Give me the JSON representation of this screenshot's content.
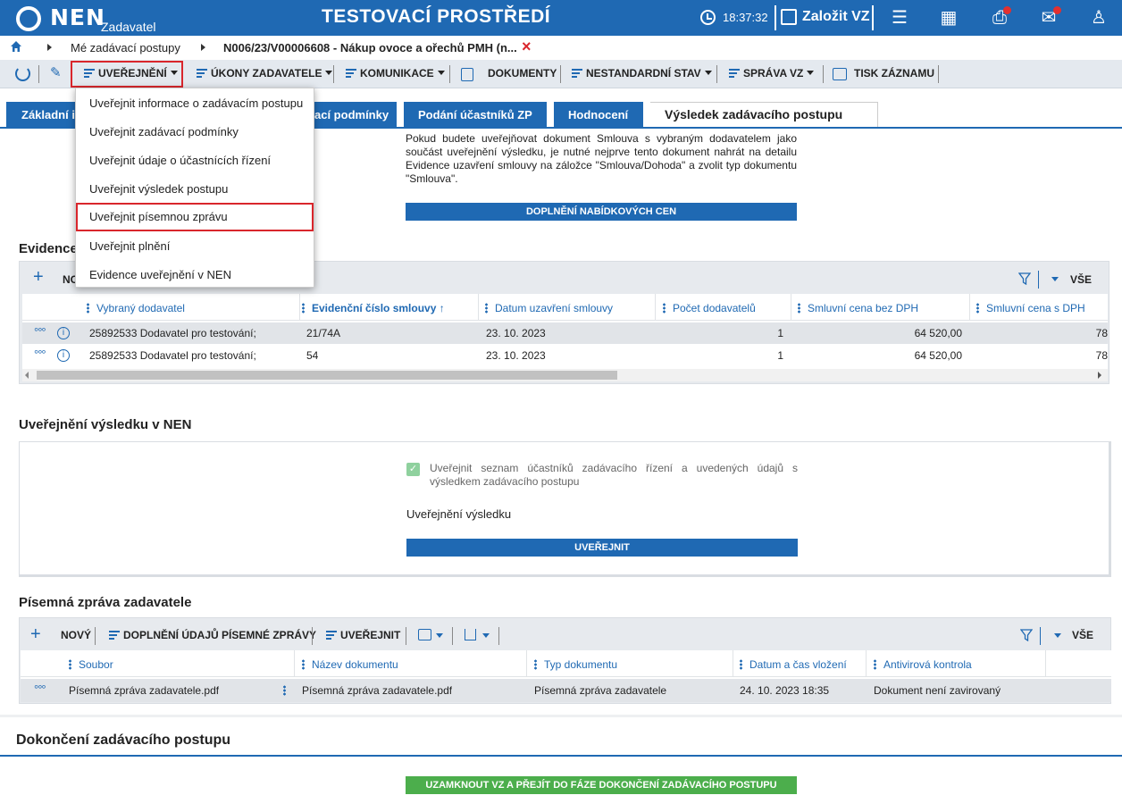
{
  "header": {
    "logo": "NEN",
    "logo_sub": "Zadavatel",
    "env_title": "TESTOVACÍ PROSTŘEDÍ",
    "clock": "18:37:32",
    "create_label": "Založit VZ"
  },
  "breadcrumb": {
    "item1": "Mé zadávací postupy",
    "item2": "N006/23/V00006608 - Nákup ovoce a ořechů PMH (n...",
    "close": "×"
  },
  "toolbar": {
    "uverejneni": "UVEŘEJNĚNÍ",
    "ukony": "ÚKONY ZADAVATELE",
    "komunikace": "KOMUNIKACE",
    "dokumenty": "DOKUMENTY",
    "nestandardni": "NESTANDARDNÍ STAV",
    "sprava": "SPRÁVA VZ",
    "tisk": "TISK ZÁZNAMU"
  },
  "dropdown": {
    "items": [
      "Uveřejnit informace o zadávacím postupu",
      "Uveřejnit zadávací podmínky",
      "Uveřejnit údaje o účastnících řízení",
      "Uveřejnit výsledek postupu",
      "Uveřejnit písemnou zprávu",
      "Uveřejnit plnění",
      "Evidence uveřejnění v NEN"
    ]
  },
  "tabs": {
    "t1": "Základní i",
    "t2": "ací podmínky",
    "t3": "Podání účastníků ZP",
    "t4": "Hodnocení",
    "active": "Výsledek zadávacího postupu"
  },
  "info": {
    "text": "Pokud budete uveřejňovat dokument Smlouva s vybraným dodavatelem jako součást uveřejnění výsledku, je nutné nejprve tento dokument nahrát na detailu Evidence uzavření smlouvy na záložce \"Smlouva/Dohoda\" a zvolit typ dokumentu \"Smlouva\".",
    "button": "DOPLNĚNÍ NABÍDKOVÝCH CEN"
  },
  "evidence": {
    "title": "Evidence",
    "new_label": "NO",
    "all_label": "VŠE",
    "columns": [
      "Vybraný dodavatel",
      "Evidenční číslo smlouvy",
      "Datum uzavření smlouvy",
      "Počet dodavatelů",
      "Smluvní cena bez DPH",
      "Smluvní cena s DPH"
    ],
    "sort_arrow": "↑",
    "rows": [
      {
        "dodavatel": "25892533 Dodavatel pro testování;",
        "cislo": "21/74A",
        "datum": "23. 10. 2023",
        "pocet": "1",
        "bez_dph": "64 520,00",
        "s_dph": "78"
      },
      {
        "dodavatel": "25892533 Dodavatel pro testování;",
        "cislo": "54",
        "datum": "23. 10. 2023",
        "pocet": "1",
        "bez_dph": "64 520,00",
        "s_dph": "78"
      }
    ]
  },
  "publication": {
    "title": "Uveřejnění výsledku v NEN",
    "checkbox_label": "Uveřejnit seznam účastníků zadávacího řízení a uvedených údajů s výsledkem zadávacího postupu",
    "checked": true,
    "subtitle": "Uveřejnění výsledku",
    "button": "UVEŘEJNIT"
  },
  "report": {
    "title": "Písemná zpráva zadavatele",
    "new": "NOVÝ",
    "doplneni": "DOPLNĚNÍ ÚDAJŮ PÍSEMNÉ ZPRÁVY",
    "uverejnit": "UVEŘEJNIT",
    "all_label": "VŠE",
    "columns": [
      "Soubor",
      "Název dokumentu",
      "Typ dokumentu",
      "Datum a čas vložení",
      "Antivirová kontrola"
    ],
    "row": {
      "soubor": "Písemná zpráva zadavatele.pdf",
      "nazev": "Písemná zpráva zadavatele.pdf",
      "typ": "Písemná zpráva zadavatele",
      "datum": "24. 10. 2023 18:35",
      "antivir": "Dokument není zavirovaný"
    }
  },
  "completion": {
    "title": "Dokončení zadávacího postupu",
    "button": "UZAMKNOUT VZ A PŘEJÍT DO FÁZE DOKONČENÍ ZADÁVACÍHO POSTUPU"
  },
  "colors": {
    "primary": "#1f69b3",
    "highlight": "#d9262c",
    "success": "#4cae4c"
  }
}
